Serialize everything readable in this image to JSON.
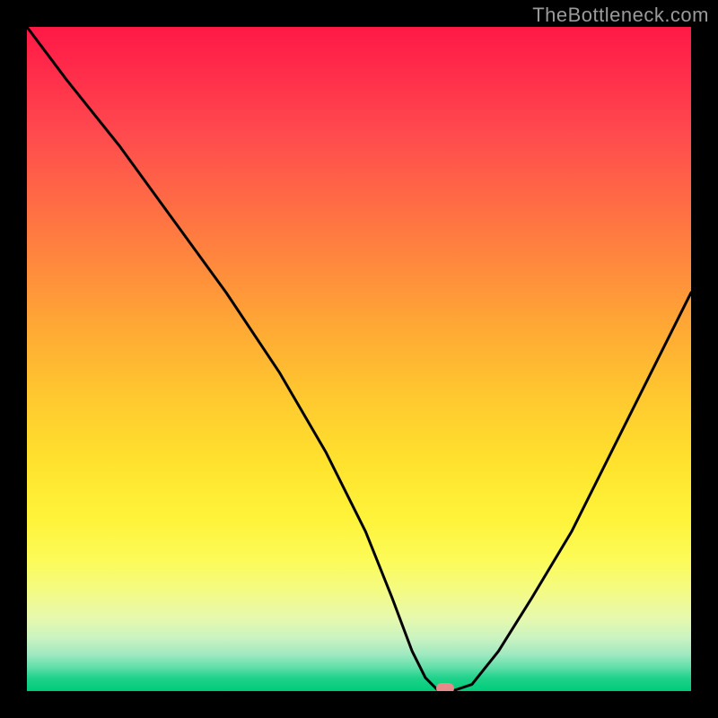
{
  "watermark": "TheBottleneck.com",
  "chart_data": {
    "type": "line",
    "title": "",
    "xlabel": "",
    "ylabel": "",
    "xlim": [
      0,
      100
    ],
    "ylim": [
      0,
      100
    ],
    "grid": false,
    "series": [
      {
        "name": "bottleneck-curve",
        "x": [
          0,
          6,
          14,
          22,
          30,
          38,
          45,
          51,
          55,
          58,
          60,
          62,
          64,
          67,
          71,
          76,
          82,
          88,
          94,
          100
        ],
        "values": [
          100,
          92,
          82,
          71,
          60,
          48,
          36,
          24,
          14,
          6,
          2,
          0,
          0,
          1,
          6,
          14,
          24,
          36,
          48,
          60
        ]
      }
    ],
    "annotations": [
      {
        "name": "optimal-marker",
        "x": 63,
        "y": 0
      }
    ],
    "background_gradient_stops": [
      {
        "pos": 0,
        "color": "#ff1946"
      },
      {
        "pos": 50,
        "color": "#ffc92f"
      },
      {
        "pos": 80,
        "color": "#fcfb56"
      },
      {
        "pos": 100,
        "color": "#00cc7a"
      }
    ]
  }
}
